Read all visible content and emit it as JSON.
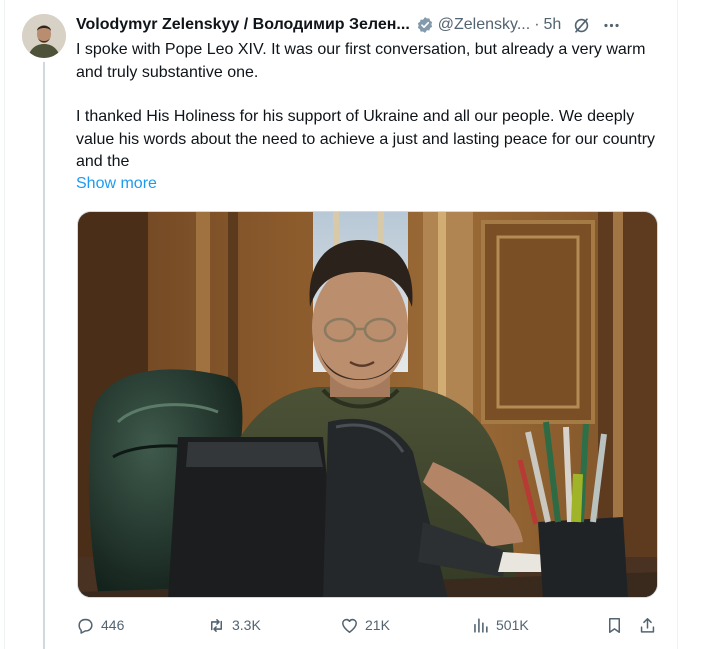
{
  "tweet": {
    "author_name": "Volodymyr Zelenskyy / Володимир Зелен...",
    "handle": "@Zelensky...",
    "separator": "·",
    "time": "5h",
    "paragraphs": [
      "I spoke with Pope Leo XIV. It was our first conversation, but already a very warm and truly substantive one.",
      "I thanked His Holiness for his support of Ukraine and all our people. We deeply value his words about the need to achieve a just and lasting peace for our country and the"
    ],
    "show_more": "Show more"
  },
  "metrics": {
    "replies": "446",
    "reposts": "3.3K",
    "likes": "21K",
    "views": "501K"
  },
  "icons": {
    "verified": "verified-badge-icon",
    "grok": "grok-icon",
    "more": "more-icon",
    "reply": "reply-icon",
    "repost": "repost-icon",
    "like": "heart-icon",
    "views": "views-icon",
    "bookmark": "bookmark-icon",
    "share": "share-icon"
  },
  "colors": {
    "text": "#0f1419",
    "secondary": "#536471",
    "link": "#1d9bf0",
    "border": "#cfd9de"
  }
}
